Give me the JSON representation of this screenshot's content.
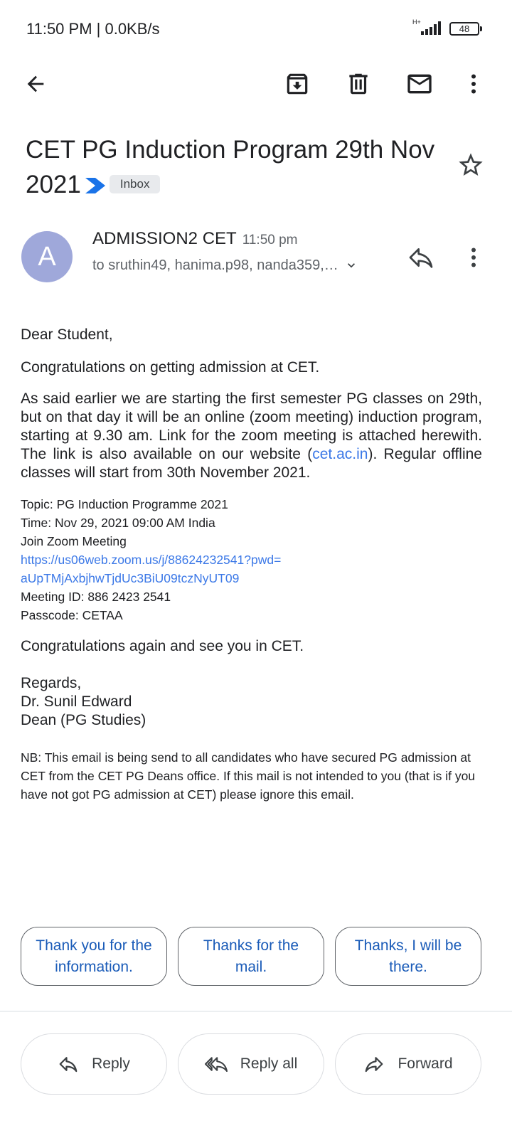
{
  "status_bar": {
    "time": "11:50 PM | 0.0KB/s",
    "network": "H+",
    "battery": "48"
  },
  "toolbar": {
    "icons": [
      "back-arrow-icon",
      "archive-icon",
      "delete-icon",
      "mark-unread-icon",
      "more-vert-icon"
    ]
  },
  "email": {
    "subject": "CET PG Induction Program 29th Nov 2021",
    "label": "Inbox",
    "sender_initial": "A",
    "sender": "ADMISSION2 CET",
    "time": "11:50 pm",
    "recipients": "to sruthin49, hanima.p98, nanda359,…",
    "greeting": "Dear Student,",
    "congrats": "Congratulations on getting admission at CET.",
    "para_before_link": "As said earlier we are starting the first semester PG classes on 29th, but on that day it will be an online (zoom meeting) induction program, starting at 9.30 am. Link for the zoom meeting is attached herewith. The link is also available on our website (",
    "website_link": "cet.ac.in",
    "para_after_link": "). Regular offline classes will start from 30th November 2021.",
    "topic": "Topic: PG Induction Programme 2021",
    "meeting_time": "Time: Nov 29, 2021 09:00 AM India",
    "join_label": "Join Zoom Meeting",
    "zoom_link_line1": "https://us06web.zoom.us/j/88624232541?pwd=",
    "zoom_link_line2": "aUpTMjAxbjhwTjdUc3BiU09tczNyUT09",
    "meeting_id": "Meeting ID: 886 2423 2541",
    "passcode": "Passcode: CETAA",
    "closing": "Congratulations again and see you in CET.",
    "regards": "Regards,",
    "signer": "Dr. Sunil Edward",
    "signer_title": "Dean (PG Studies)",
    "nb": "NB: This email is being send to all candidates who have secured PG admission at CET from the CET PG Deans office. If this mail is not intended to you (that is if you have not got PG admission at CET) please ignore this email."
  },
  "smart_replies": [
    "Thank you for the information.",
    "Thanks for the mail.",
    "Thanks, I will be there."
  ],
  "actions": {
    "reply": "Reply",
    "reply_all": "Reply all",
    "forward": "Forward"
  },
  "colors": {
    "avatar": "#9fa8da",
    "link": "#3b78e7",
    "smart_reply_text": "#1a5bb8",
    "label_chip": "#e8eaed",
    "chevron": "#1a73e8"
  }
}
